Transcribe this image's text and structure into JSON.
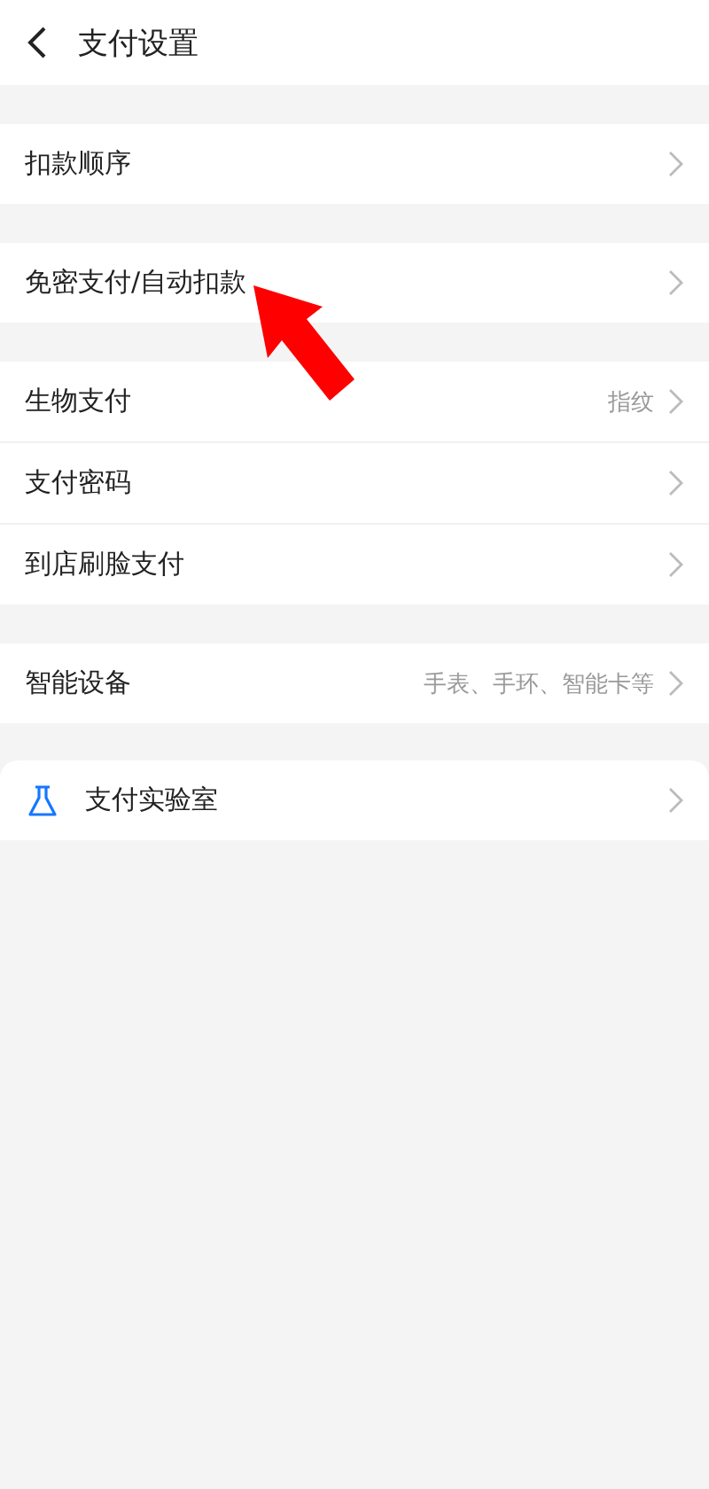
{
  "header": {
    "title": "支付设置"
  },
  "groups": [
    [
      {
        "label": "扣款顺序"
      }
    ],
    [
      {
        "label": "免密支付/自动扣款"
      }
    ],
    [
      {
        "label": "生物支付",
        "value": "指纹"
      },
      {
        "label": "支付密码"
      },
      {
        "label": "到店刷脸支付"
      }
    ],
    [
      {
        "label": "智能设备",
        "value": "手表、手环、智能卡等"
      }
    ]
  ],
  "lab": {
    "label": "支付实验室"
  }
}
